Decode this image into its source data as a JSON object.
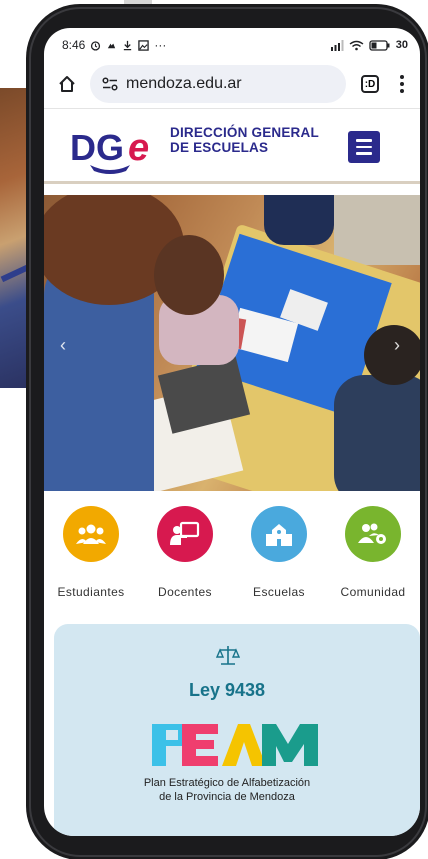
{
  "status_bar": {
    "time": "8:46",
    "more": "···",
    "battery": "30"
  },
  "browser": {
    "url": "mendoza.edu.ar",
    "tab_count": ":D"
  },
  "site": {
    "logo_text_line1": "DIRECCIÓN GENERAL",
    "logo_text_line2": "DE ESCUELAS",
    "brand_color": "#2b2a8c"
  },
  "hero": {
    "prev_arrow": "‹",
    "next_arrow": "›"
  },
  "quick_links": [
    {
      "label": "Estudiantes",
      "color": "#f2a900",
      "icon": "students-icon"
    },
    {
      "label": "Docentes",
      "color": "#d7194f",
      "icon": "teacher-icon"
    },
    {
      "label": "Escuelas",
      "color": "#4aa9dd",
      "icon": "school-icon"
    },
    {
      "label": "Comunidad",
      "color": "#79b52e",
      "icon": "community-icon"
    }
  ],
  "ley": {
    "title": "Ley 9438",
    "subtitle_line1": "Plan Estratégico de Alfabetización",
    "subtitle_line2": "de la Provincia de Mendoza"
  }
}
